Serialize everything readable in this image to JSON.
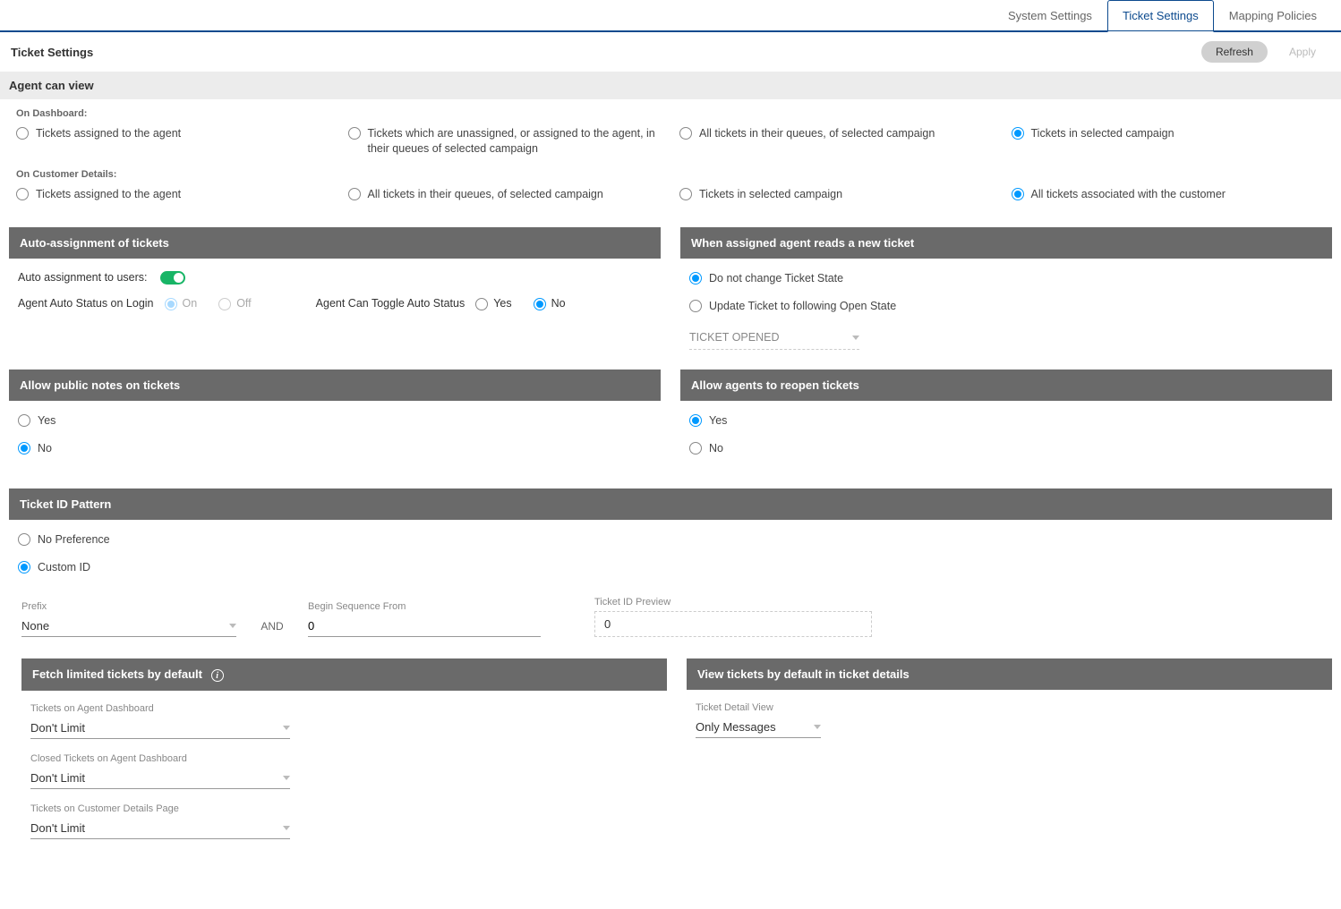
{
  "tabs": {
    "system_settings": "System Settings",
    "ticket_settings": "Ticket Settings",
    "mapping_policies": "Mapping Policies"
  },
  "page_title": "Ticket Settings",
  "buttons": {
    "refresh": "Refresh",
    "apply": "Apply"
  },
  "agent_can_view": {
    "header": "Agent can view",
    "on_dashboard_label": "On Dashboard:",
    "dashboard_options": {
      "assigned": "Tickets assigned to the agent",
      "unassigned_or_assigned": "Tickets which are unassigned, or assigned to the agent, in their queues of selected campaign",
      "all_in_queues": "All tickets in their queues, of selected campaign",
      "in_selected_campaign": "Tickets in selected campaign"
    },
    "on_customer_label": "On Customer Details:",
    "customer_options": {
      "assigned": "Tickets assigned to the agent",
      "all_in_queues": "All tickets in their queues, of selected campaign",
      "in_selected_campaign": "Tickets in selected campaign",
      "all_associated": "All tickets associated with the customer"
    }
  },
  "auto_assign": {
    "header": "Auto-assignment of tickets",
    "auto_assignment_label": "Auto assignment to users:",
    "agent_auto_status_label": "Agent Auto Status on Login",
    "on": "On",
    "off": "Off",
    "agent_toggle_label": "Agent Can Toggle Auto Status",
    "yes": "Yes",
    "no": "No"
  },
  "assigned_reads": {
    "header": "When assigned agent reads a new ticket",
    "do_not_change": "Do not change Ticket State",
    "update_to": "Update Ticket to following Open State",
    "select_value": "TICKET OPENED"
  },
  "public_notes": {
    "header": "Allow public notes on tickets",
    "yes": "Yes",
    "no": "No"
  },
  "reopen": {
    "header": "Allow agents to reopen tickets",
    "yes": "Yes",
    "no": "No"
  },
  "ticket_id_pattern": {
    "header": "Ticket ID Pattern",
    "no_preference": "No Preference",
    "custom_id": "Custom ID",
    "prefix_label": "Prefix",
    "prefix_value": "None",
    "and": "AND",
    "begin_seq_label": "Begin Sequence From",
    "begin_seq_value": "0",
    "preview_label": "Ticket ID Preview",
    "preview_value": "0"
  },
  "fetch_limited": {
    "header": "Fetch limited tickets by default",
    "agent_dashboard_label": "Tickets on Agent Dashboard",
    "agent_dashboard_value": "Don't Limit",
    "closed_label": "Closed Tickets on Agent Dashboard",
    "closed_value": "Don't Limit",
    "customer_label": "Tickets on Customer Details Page",
    "customer_value": "Don't Limit"
  },
  "view_default": {
    "header": "View tickets by default in ticket details",
    "detail_label": "Ticket Detail View",
    "detail_value": "Only Messages"
  }
}
